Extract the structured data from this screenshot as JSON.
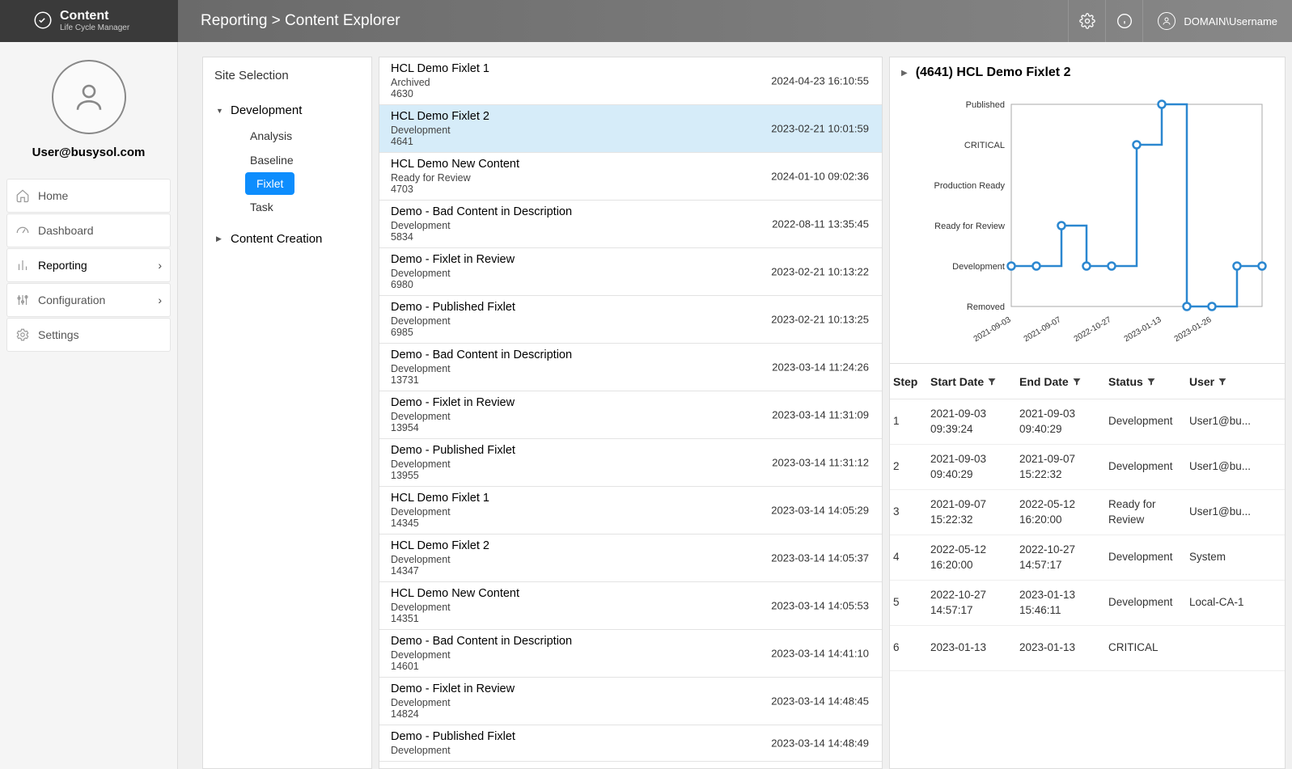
{
  "brand": {
    "title": "Content",
    "subtitle": "Life Cycle Manager"
  },
  "breadcrumb": "Reporting  >  Content Explorer",
  "topbar": {
    "user": "DOMAIN\\Username"
  },
  "profile": {
    "email": "User@busysol.com"
  },
  "nav": {
    "home": "Home",
    "dashboard": "Dashboard",
    "reporting": "Reporting",
    "configuration": "Configuration",
    "settings": "Settings"
  },
  "tree": {
    "header": "Site Selection",
    "node_dev": "Development",
    "leaf_analysis": "Analysis",
    "leaf_baseline": "Baseline",
    "leaf_fixlet": "Fixlet",
    "leaf_task": "Task",
    "node_cc": "Content Creation"
  },
  "list": [
    {
      "title": "HCL Demo Fixlet 1",
      "status": "Archived",
      "id": "4630",
      "date": "2024-04-23 16:10:55"
    },
    {
      "title": "HCL Demo Fixlet 2",
      "status": "Development",
      "id": "4641",
      "date": "2023-02-21 10:01:59",
      "selected": true
    },
    {
      "title": "HCL Demo New Content",
      "status": "Ready for Review",
      "id": "4703",
      "date": "2024-01-10 09:02:36"
    },
    {
      "title": "Demo - Bad Content in Description",
      "status": "Development",
      "id": "5834",
      "date": "2022-08-11 13:35:45"
    },
    {
      "title": "Demo - Fixlet in Review",
      "status": "Development",
      "id": "6980",
      "date": "2023-02-21 10:13:22"
    },
    {
      "title": "Demo - Published Fixlet",
      "status": "Development",
      "id": "6985",
      "date": "2023-02-21 10:13:25"
    },
    {
      "title": "Demo - Bad Content in Description",
      "status": "Development",
      "id": "13731",
      "date": "2023-03-14 11:24:26"
    },
    {
      "title": "Demo - Fixlet in Review",
      "status": "Development",
      "id": "13954",
      "date": "2023-03-14 11:31:09"
    },
    {
      "title": "Demo - Published Fixlet",
      "status": "Development",
      "id": "13955",
      "date": "2023-03-14 11:31:12"
    },
    {
      "title": "HCL Demo Fixlet 1",
      "status": "Development",
      "id": "14345",
      "date": "2023-03-14 14:05:29"
    },
    {
      "title": "HCL Demo Fixlet 2",
      "status": "Development",
      "id": "14347",
      "date": "2023-03-14 14:05:37"
    },
    {
      "title": "HCL Demo New Content",
      "status": "Development",
      "id": "14351",
      "date": "2023-03-14 14:05:53"
    },
    {
      "title": "Demo - Bad Content in Description",
      "status": "Development",
      "id": "14601",
      "date": "2023-03-14 14:41:10"
    },
    {
      "title": "Demo - Fixlet in Review",
      "status": "Development",
      "id": "14824",
      "date": "2023-03-14 14:48:45"
    },
    {
      "title": "Demo - Published Fixlet",
      "status": "Development",
      "id": "",
      "date": "2023-03-14 14:48:49"
    }
  ],
  "detail": {
    "title": "(4641) HCL Demo Fixlet 2",
    "table_headers": {
      "step": "Step",
      "start": "Start Date",
      "end": "End Date",
      "status": "Status",
      "user": "User"
    },
    "rows": [
      {
        "step": "1",
        "start": "2021-09-03 09:39:24",
        "end": "2021-09-03 09:40:29",
        "status": "Development",
        "user": "User1@bu..."
      },
      {
        "step": "2",
        "start": "2021-09-03 09:40:29",
        "end": "2021-09-07 15:22:32",
        "status": "Development",
        "user": "User1@bu..."
      },
      {
        "step": "3",
        "start": "2021-09-07 15:22:32",
        "end": "2022-05-12 16:20:00",
        "status": "Ready for Review",
        "user": "User1@bu..."
      },
      {
        "step": "4",
        "start": "2022-05-12 16:20:00",
        "end": "2022-10-27 14:57:17",
        "status": "Development",
        "user": "System"
      },
      {
        "step": "5",
        "start": "2022-10-27 14:57:17",
        "end": "2023-01-13 15:46:11",
        "status": "Development",
        "user": "Local-CA-1"
      },
      {
        "step": "6",
        "start": "2023-01-13",
        "end": "2023-01-13",
        "status": "CRITICAL",
        "user": ""
      }
    ]
  },
  "chart_data": {
    "type": "line-step",
    "title": "",
    "ylabel": "",
    "y_categories": [
      "Removed",
      "Development",
      "Ready for Review",
      "Production Ready",
      "CRITICAL",
      "Published"
    ],
    "x_tick_labels": [
      "2021-09-03",
      "2021-09-07",
      "2022-10-27",
      "2023-01-13",
      "2023-01-26"
    ],
    "points": [
      {
        "x": "2021-09-03",
        "y": "Development"
      },
      {
        "x": "2021-09-03b",
        "y": "Development"
      },
      {
        "x": "2021-09-07",
        "y": "Ready for Review"
      },
      {
        "x": "2022-05-12",
        "y": "Development"
      },
      {
        "x": "2022-10-27",
        "y": "Development"
      },
      {
        "x": "2023-01-13",
        "y": "CRITICAL"
      },
      {
        "x": "2023-01-13b",
        "y": "Published"
      },
      {
        "x": "2023-01-26",
        "y": "Removed"
      },
      {
        "x": "2023-01-26b",
        "y": "Removed"
      },
      {
        "x": "2023-02-21",
        "y": "Development"
      },
      {
        "x": "2023-02-21b",
        "y": "Development"
      }
    ]
  }
}
